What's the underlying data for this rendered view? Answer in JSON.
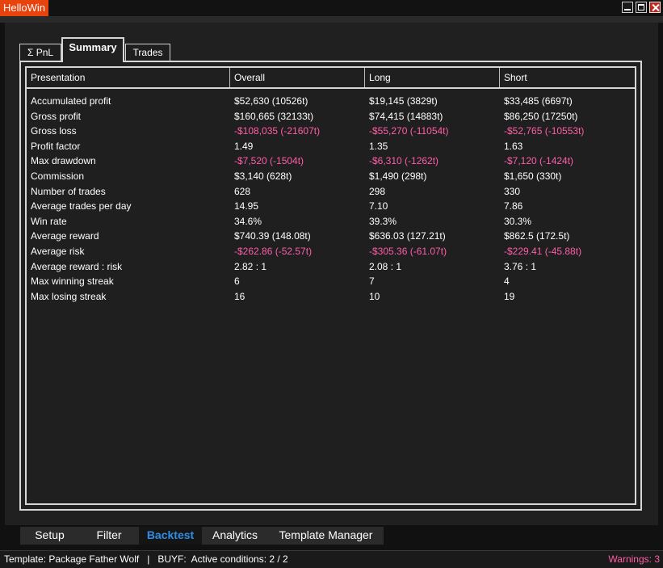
{
  "window": {
    "title": "HelloWin"
  },
  "tabs": [
    {
      "label": "Σ PnL"
    },
    {
      "label": "Summary"
    },
    {
      "label": "Trades"
    }
  ],
  "table": {
    "headers": [
      "Presentation",
      "Overall",
      "Long",
      "Short"
    ],
    "rows": [
      {
        "label": "Accumulated profit",
        "overall": "$52,630 (10526t)",
        "long": "$19,145 (3829t)",
        "short": "$33,485 (6697t)"
      },
      {
        "label": "Gross profit",
        "overall": "$160,665 (32133t)",
        "long": "$74,415 (14883t)",
        "short": "$86,250 (17250t)"
      },
      {
        "label": "Gross loss",
        "overall": "-$108,035 (-21607t)",
        "long": "-$55,270 (-11054t)",
        "short": "-$52,765 (-10553t)",
        "negative": true
      },
      {
        "label": "Profit factor",
        "overall": "1.49",
        "long": "1.35",
        "short": "1.63"
      },
      {
        "label": "Max drawdown",
        "overall": "-$7,520 (-1504t)",
        "long": "-$6,310 (-1262t)",
        "short": "-$7,120 (-1424t)",
        "negative": true
      },
      {
        "label": "Commission",
        "overall": "$3,140 (628t)",
        "long": "$1,490 (298t)",
        "short": "$1,650 (330t)"
      },
      {
        "label": "Number of trades",
        "overall": "628",
        "long": "298",
        "short": "330"
      },
      {
        "label": "Average trades per day",
        "overall": "14.95",
        "long": "7.10",
        "short": "7.86"
      },
      {
        "label": "Win rate",
        "overall": "34.6%",
        "long": "39.3%",
        "short": "30.3%"
      },
      {
        "label": "Average reward",
        "overall": "$740.39 (148.08t)",
        "long": "$636.03 (127.21t)",
        "short": "$862.5 (172.5t)"
      },
      {
        "label": "Average risk",
        "overall": "-$262.86 (-52.57t)",
        "long": "-$305.36 (-61.07t)",
        "short": "-$229.41 (-45.88t)",
        "negative": true
      },
      {
        "label": "Average reward : risk",
        "overall": "2.82 : 1",
        "long": "2.08 : 1",
        "short": "3.76 : 1"
      },
      {
        "label": "Max winning streak",
        "overall": "6",
        "long": "7",
        "short": "4"
      },
      {
        "label": "Max losing streak",
        "overall": "16",
        "long": "10",
        "short": "19"
      }
    ]
  },
  "bottom_tabs": [
    {
      "label": "Setup"
    },
    {
      "label": "Filter"
    },
    {
      "label": "Backtest"
    },
    {
      "label": "Analytics"
    },
    {
      "label": "Template Manager"
    }
  ],
  "status": {
    "left": "Template: Package Father Wolf   |   BUYF:  Active conditions: 2 / 2",
    "right": "Warnings: 3"
  },
  "colors": {
    "title_accent": "#e8420d",
    "negative": "#ff5ea8",
    "active_tab": "#2f8fe6"
  },
  "icons": [
    "minimize-icon",
    "maximize-icon",
    "close-icon"
  ]
}
